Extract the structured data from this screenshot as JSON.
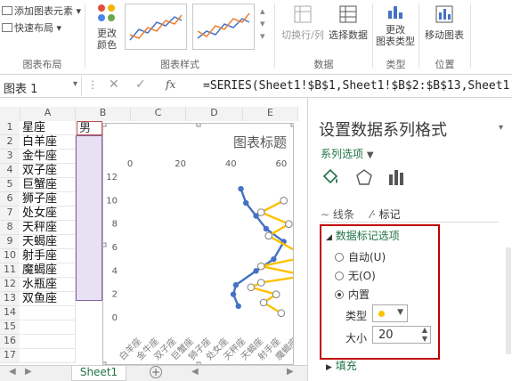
{
  "ribbon": {
    "add_element": "添加图表元素",
    "quick_layout": "快速布局",
    "change_colors": "更改\n颜色",
    "switch_row_col": "切换行/列",
    "select_data": "选择数据",
    "change_type": "更改\n图表类型",
    "move_chart": "移动图表",
    "groups": [
      "图表布局",
      "图表样式",
      "数据",
      "类型",
      "位置"
    ]
  },
  "formula": {
    "name_box": "图表 1",
    "fx": "fx",
    "content": "=SERIES(Sheet1!$B$1,Sheet1!$B$2:$B$13,Sheet1!"
  },
  "sheet": {
    "columns": [
      "A",
      "B",
      "C",
      "D",
      "E"
    ],
    "rows": [
      {
        "num": "1",
        "a": "星座",
        "b": "男性"
      },
      {
        "num": "2",
        "a": "白羊座"
      },
      {
        "num": "3",
        "a": "金牛座"
      },
      {
        "num": "4",
        "a": "双子座"
      },
      {
        "num": "5",
        "a": "巨蟹座"
      },
      {
        "num": "6",
        "a": "狮子座"
      },
      {
        "num": "7",
        "a": "处女座"
      },
      {
        "num": "8",
        "a": "天秤座"
      },
      {
        "num": "9",
        "a": "天蝎座"
      },
      {
        "num": "10",
        "a": "射手座"
      },
      {
        "num": "11",
        "a": "魔蝎座"
      },
      {
        "num": "12",
        "a": "水瓶座"
      },
      {
        "num": "13",
        "a": "双鱼座"
      },
      {
        "num": "14"
      },
      {
        "num": "15"
      },
      {
        "num": "16"
      },
      {
        "num": "17"
      }
    ],
    "tab": "Sheet1"
  },
  "chart_data": {
    "type": "line",
    "title": "图表标题",
    "x_ticks": [
      "0",
      "20",
      "40",
      "60"
    ],
    "y_ticks": [
      "12",
      "10",
      "8",
      "6",
      "4",
      "2",
      "0"
    ],
    "xlim": [
      0,
      65
    ],
    "ylim": [
      0,
      12
    ],
    "categories": [
      "白羊座",
      "金牛座",
      "双子座",
      "巨蟹座",
      "狮子座",
      "处女座",
      "天秤座",
      "天蝎座",
      "射手座",
      "魔蝎座"
    ],
    "series": [
      {
        "color": "#4472c4",
        "points": [
          [
            43,
            1
          ],
          [
            41,
            2
          ],
          [
            42,
            2.8
          ],
          [
            50,
            4
          ],
          [
            57,
            5
          ],
          [
            61,
            6.5
          ],
          [
            54,
            7.6
          ],
          [
            50,
            8.7
          ],
          [
            46,
            9.8
          ],
          [
            44,
            11
          ]
        ]
      },
      {
        "color": "#ffc000",
        "points": [
          [
            60,
            0.4
          ],
          [
            53,
            1.3
          ],
          [
            58,
            2
          ],
          [
            48,
            2.6
          ],
          [
            52,
            3
          ],
          [
            70,
            3.6
          ],
          [
            52,
            4.4
          ],
          [
            70,
            5.2
          ],
          [
            55,
            7
          ],
          [
            63,
            8
          ],
          [
            52,
            9
          ],
          [
            61,
            10
          ]
        ]
      }
    ]
  },
  "pane": {
    "title": "设置数据系列格式",
    "series_options": "系列选项",
    "tab_line": "线条",
    "tab_marker": "标记",
    "section_marker_opts": "数据标记选项",
    "auto": "自动(U)",
    "none": "无(O)",
    "builtin": "内置",
    "type_label": "类型",
    "size_label": "大小",
    "size_value": "20",
    "section_fill": "填充",
    "marker_color": "#ffc000"
  }
}
